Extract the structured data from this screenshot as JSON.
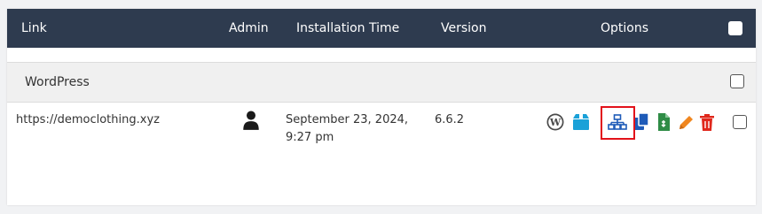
{
  "table": {
    "headers": {
      "link": "Link",
      "admin": "Admin",
      "installation_time": "Installation Time",
      "version": "Version",
      "options": "Options"
    },
    "group": {
      "label": "WordPress"
    },
    "rows": [
      {
        "link": "https://democlothing.xyz",
        "installation_time_line1": "September 23, 2024,",
        "installation_time_line2": "9:27 pm",
        "version": "6.6.2"
      }
    ]
  },
  "icons": {
    "admin": "user-icon",
    "options": [
      "wordpress-icon",
      "backup-box-icon",
      "sitemap-icon",
      "copy-icon",
      "export-file-icon",
      "edit-pencil-icon",
      "delete-trash-icon"
    ]
  },
  "colors": {
    "header_bg": "#2e3b4f",
    "box_icon": "#1aa1d8",
    "sitemap_icon": "#1e5bb8",
    "copy_icon": "#1e5bb8",
    "file_icon": "#2f8c46",
    "pencil_icon": "#f0861f",
    "trash_icon": "#e0281c",
    "highlight": "#e2121a"
  }
}
